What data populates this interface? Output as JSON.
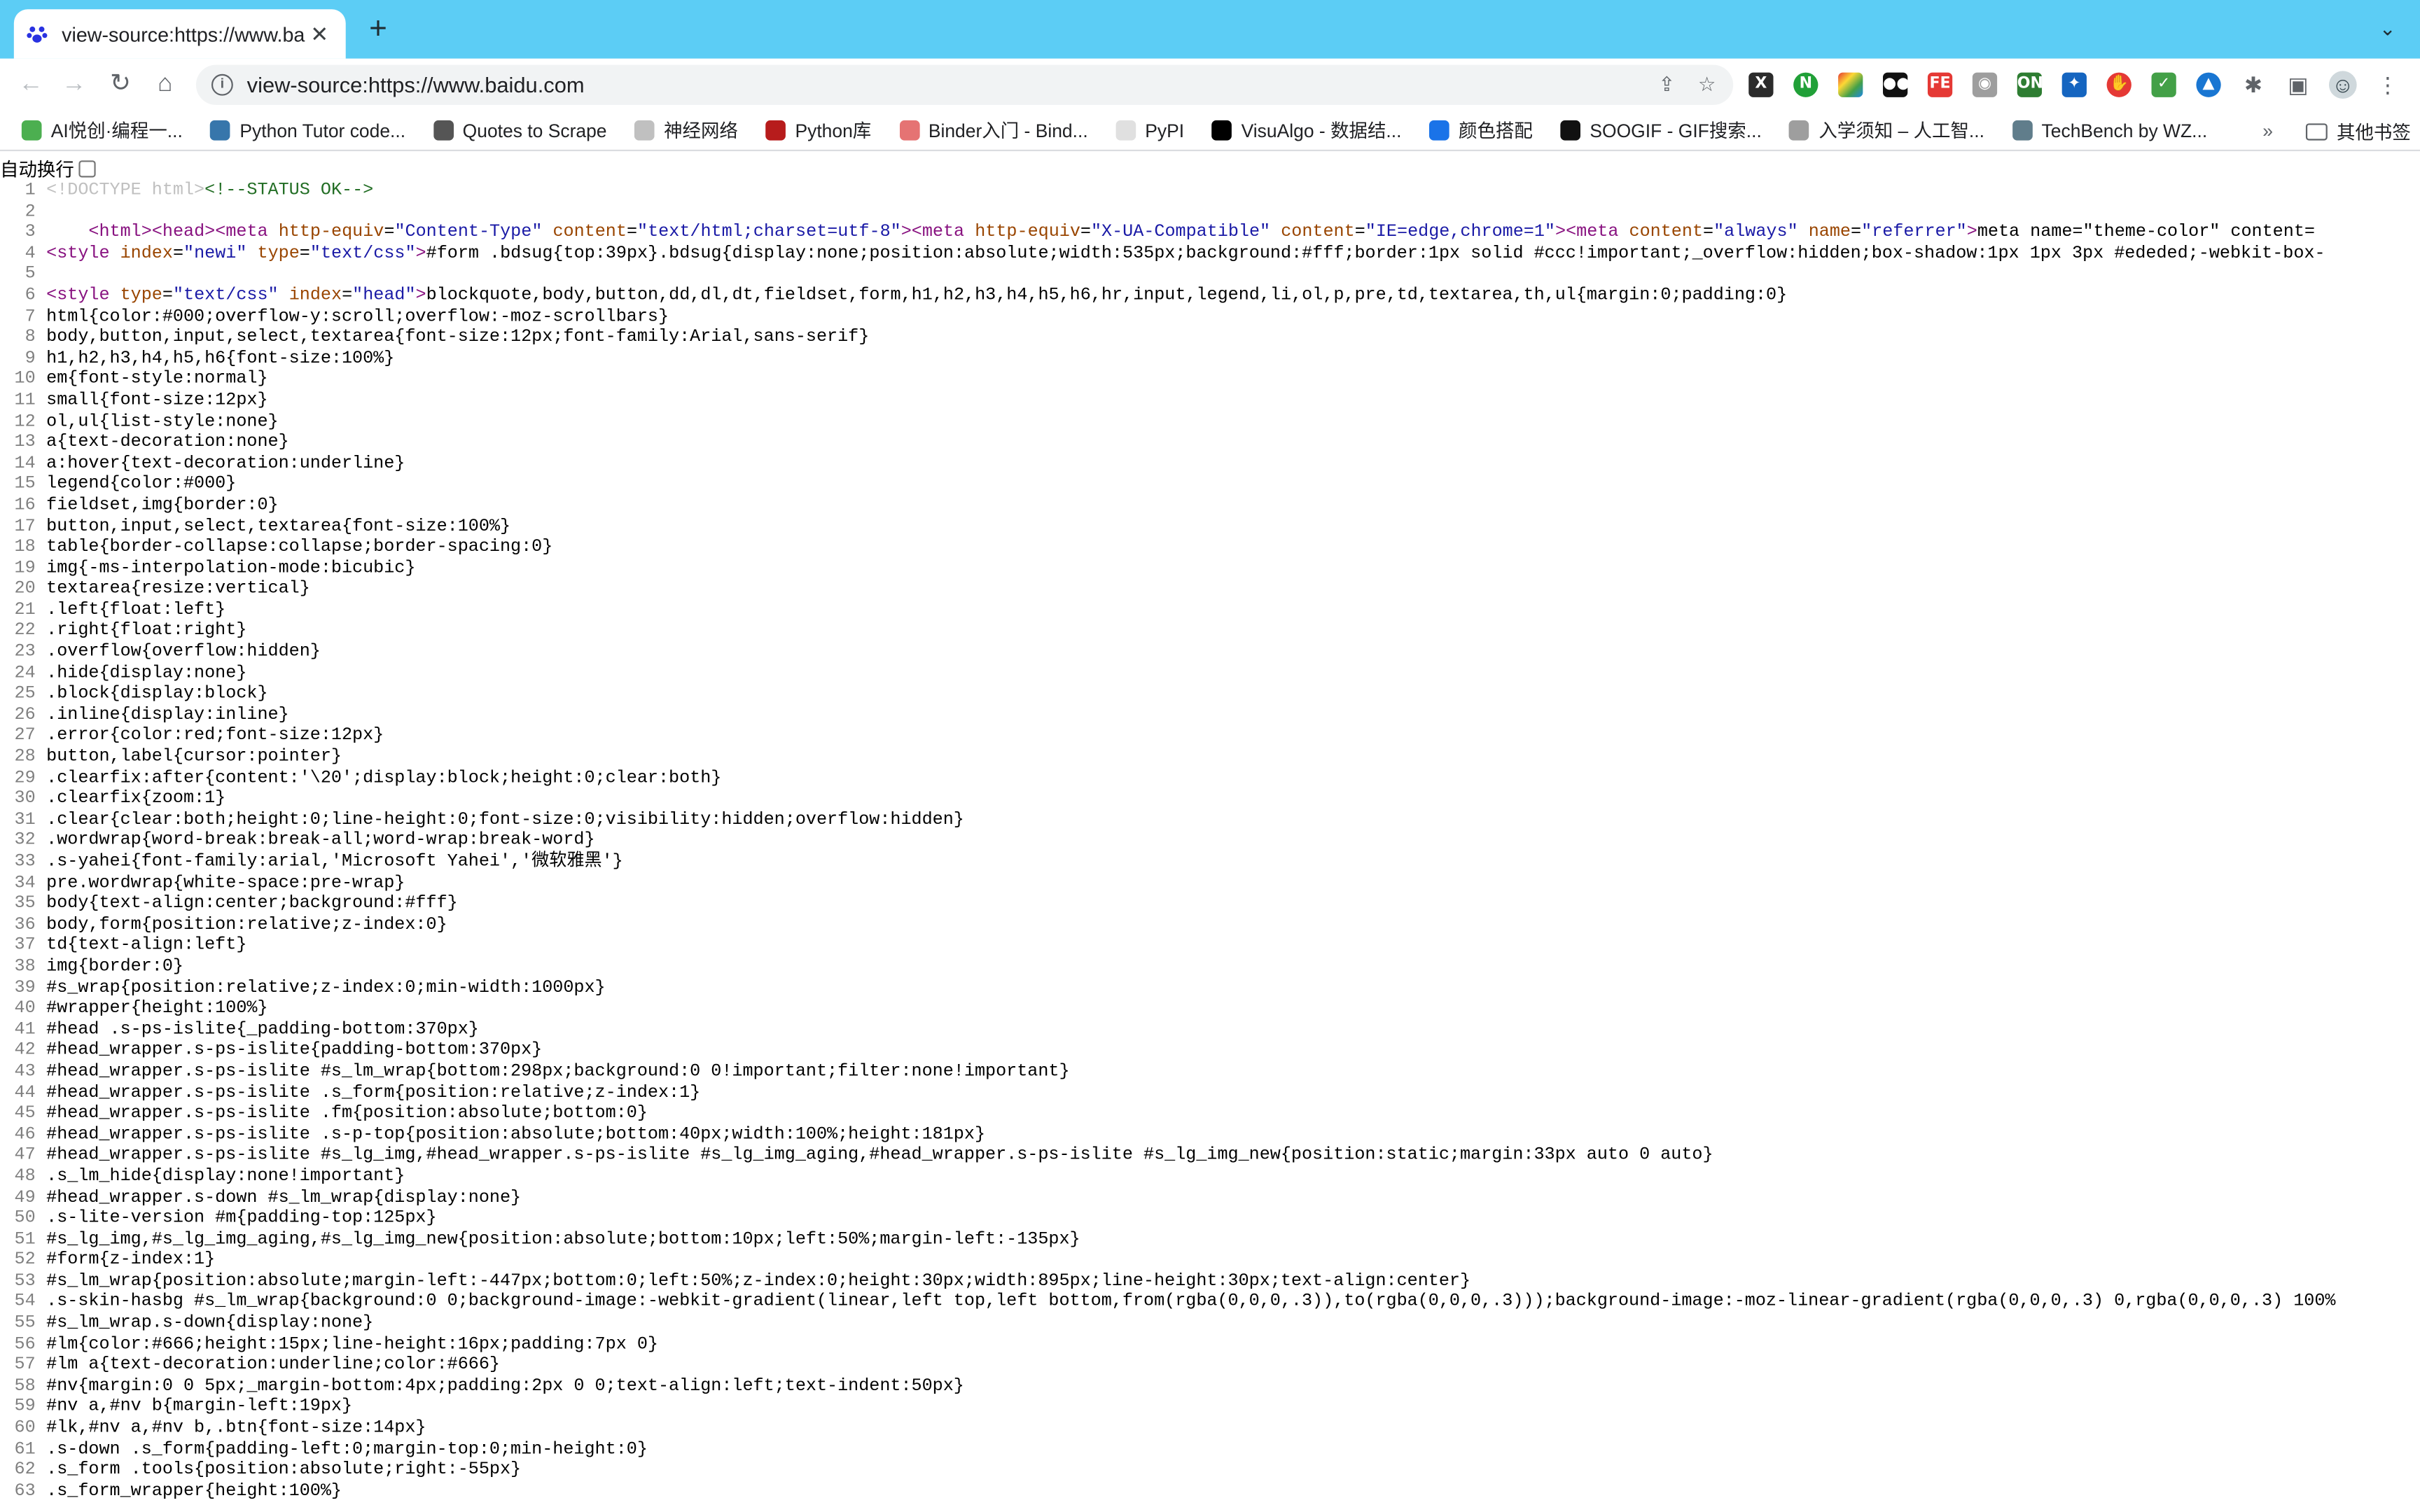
{
  "browser": {
    "tab_title": "view-source:https://www.baidu.com",
    "url": "view-source:https://www.baidu.com"
  },
  "bookmarks": {
    "items": [
      {
        "label": "AI悦创·编程一...",
        "color": "#4caf50"
      },
      {
        "label": "Python Tutor code...",
        "color": "#3776ab"
      },
      {
        "label": "Quotes to Scrape",
        "color": "#555555"
      },
      {
        "label": "神经网络",
        "color": "#c0c0c0"
      },
      {
        "label": "Python库",
        "color": "#b71c1c"
      },
      {
        "label": "Binder入门 - Bind...",
        "color": "#e57373"
      },
      {
        "label": "PyPI",
        "color": "#e0e0e0"
      },
      {
        "label": "VisuAlgo - 数据结...",
        "color": "#000000"
      },
      {
        "label": "颜色搭配",
        "color": "#1a73e8"
      },
      {
        "label": "SOOGIF - GIF搜索...",
        "color": "#111111"
      },
      {
        "label": "入学须知 – 人工智...",
        "color": "#9e9e9e"
      },
      {
        "label": "TechBench by WZ...",
        "color": "#607d8b"
      }
    ],
    "more": "»",
    "other_label": "其他书签"
  },
  "source_view": {
    "wrap_label": "自动换行",
    "lines": [
      {
        "n": "1",
        "t": "<!DOCTYPE html><!--STATUS OK-->"
      },
      {
        "n": "2",
        "t": ""
      },
      {
        "n": "3",
        "t": "    <html><head><meta http-equiv=\"Content-Type\" content=\"text/html;charset=utf-8\"><meta http-equiv=\"X-UA-Compatible\" content=\"IE=edge,chrome=1\"><meta content=\"always\" name=\"referrer\"><meta name=\"theme-color\" content="
      },
      {
        "n": "4",
        "t": "<style index=\"newi\" type=\"text/css\">#form .bdsug{top:39px}.bdsug{display:none;position:absolute;width:535px;background:#fff;border:1px solid #ccc!important;_overflow:hidden;box-shadow:1px 1px 3px #ededed;-webkit-box-"
      },
      {
        "n": "5",
        "t": ""
      },
      {
        "n": "6",
        "t": "<style type=\"text/css\" index=\"head\">blockquote,body,button,dd,dl,dt,fieldset,form,h1,h2,h3,h4,h5,h6,hr,input,legend,li,ol,p,pre,td,textarea,th,ul{margin:0;padding:0}"
      },
      {
        "n": "7",
        "t": "html{color:#000;overflow-y:scroll;overflow:-moz-scrollbars}"
      },
      {
        "n": "8",
        "t": "body,button,input,select,textarea{font-size:12px;font-family:Arial,sans-serif}"
      },
      {
        "n": "9",
        "t": "h1,h2,h3,h4,h5,h6{font-size:100%}"
      },
      {
        "n": "10",
        "t": "em{font-style:normal}"
      },
      {
        "n": "11",
        "t": "small{font-size:12px}"
      },
      {
        "n": "12",
        "t": "ol,ul{list-style:none}"
      },
      {
        "n": "13",
        "t": "a{text-decoration:none}"
      },
      {
        "n": "14",
        "t": "a:hover{text-decoration:underline}"
      },
      {
        "n": "15",
        "t": "legend{color:#000}"
      },
      {
        "n": "16",
        "t": "fieldset,img{border:0}"
      },
      {
        "n": "17",
        "t": "button,input,select,textarea{font-size:100%}"
      },
      {
        "n": "18",
        "t": "table{border-collapse:collapse;border-spacing:0}"
      },
      {
        "n": "19",
        "t": "img{-ms-interpolation-mode:bicubic}"
      },
      {
        "n": "20",
        "t": "textarea{resize:vertical}"
      },
      {
        "n": "21",
        "t": ".left{float:left}"
      },
      {
        "n": "22",
        "t": ".right{float:right}"
      },
      {
        "n": "23",
        "t": ".overflow{overflow:hidden}"
      },
      {
        "n": "24",
        "t": ".hide{display:none}"
      },
      {
        "n": "25",
        "t": ".block{display:block}"
      },
      {
        "n": "26",
        "t": ".inline{display:inline}"
      },
      {
        "n": "27",
        "t": ".error{color:red;font-size:12px}"
      },
      {
        "n": "28",
        "t": "button,label{cursor:pointer}"
      },
      {
        "n": "29",
        "t": ".clearfix:after{content:'\\20';display:block;height:0;clear:both}"
      },
      {
        "n": "30",
        "t": ".clearfix{zoom:1}"
      },
      {
        "n": "31",
        "t": ".clear{clear:both;height:0;line-height:0;font-size:0;visibility:hidden;overflow:hidden}"
      },
      {
        "n": "32",
        "t": ".wordwrap{word-break:break-all;word-wrap:break-word}"
      },
      {
        "n": "33",
        "t": ".s-yahei{font-family:arial,'Microsoft Yahei','微软雅黑'}"
      },
      {
        "n": "34",
        "t": "pre.wordwrap{white-space:pre-wrap}"
      },
      {
        "n": "35",
        "t": "body{text-align:center;background:#fff}"
      },
      {
        "n": "36",
        "t": "body,form{position:relative;z-index:0}"
      },
      {
        "n": "37",
        "t": "td{text-align:left}"
      },
      {
        "n": "38",
        "t": "img{border:0}"
      },
      {
        "n": "39",
        "t": "#s_wrap{position:relative;z-index:0;min-width:1000px}"
      },
      {
        "n": "40",
        "t": "#wrapper{height:100%}"
      },
      {
        "n": "41",
        "t": "#head .s-ps-islite{_padding-bottom:370px}"
      },
      {
        "n": "42",
        "t": "#head_wrapper.s-ps-islite{padding-bottom:370px}"
      },
      {
        "n": "43",
        "t": "#head_wrapper.s-ps-islite #s_lm_wrap{bottom:298px;background:0 0!important;filter:none!important}"
      },
      {
        "n": "44",
        "t": "#head_wrapper.s-ps-islite .s_form{position:relative;z-index:1}"
      },
      {
        "n": "45",
        "t": "#head_wrapper.s-ps-islite .fm{position:absolute;bottom:0}"
      },
      {
        "n": "46",
        "t": "#head_wrapper.s-ps-islite .s-p-top{position:absolute;bottom:40px;width:100%;height:181px}"
      },
      {
        "n": "47",
        "t": "#head_wrapper.s-ps-islite #s_lg_img,#head_wrapper.s-ps-islite #s_lg_img_aging,#head_wrapper.s-ps-islite #s_lg_img_new{position:static;margin:33px auto 0 auto}"
      },
      {
        "n": "48",
        "t": ".s_lm_hide{display:none!important}"
      },
      {
        "n": "49",
        "t": "#head_wrapper.s-down #s_lm_wrap{display:none}"
      },
      {
        "n": "50",
        "t": ".s-lite-version #m{padding-top:125px}"
      },
      {
        "n": "51",
        "t": "#s_lg_img,#s_lg_img_aging,#s_lg_img_new{position:absolute;bottom:10px;left:50%;margin-left:-135px}"
      },
      {
        "n": "52",
        "t": "#form{z-index:1}"
      },
      {
        "n": "53",
        "t": "#s_lm_wrap{position:absolute;margin-left:-447px;bottom:0;left:50%;z-index:0;height:30px;width:895px;line-height:30px;text-align:center}"
      },
      {
        "n": "54",
        "t": ".s-skin-hasbg #s_lm_wrap{background:0 0;background-image:-webkit-gradient(linear,left top,left bottom,from(rgba(0,0,0,.3)),to(rgba(0,0,0,.3)));background-image:-moz-linear-gradient(rgba(0,0,0,.3) 0,rgba(0,0,0,.3) 100%"
      },
      {
        "n": "55",
        "t": "#s_lm_wrap.s-down{display:none}"
      },
      {
        "n": "56",
        "t": "#lm{color:#666;height:15px;line-height:16px;padding:7px 0}"
      },
      {
        "n": "57",
        "t": "#lm a{text-decoration:underline;color:#666}"
      },
      {
        "n": "58",
        "t": "#nv{margin:0 0 5px;_margin-bottom:4px;padding:2px 0 0;text-align:left;text-indent:50px}"
      },
      {
        "n": "59",
        "t": "#nv a,#nv b{margin-left:19px}"
      },
      {
        "n": "60",
        "t": "#lk,#nv a,#nv b,.btn{font-size:14px}"
      },
      {
        "n": "61",
        "t": ".s-down .s_form{padding-left:0;margin-top:0;min-height:0}"
      },
      {
        "n": "62",
        "t": ".s_form .tools{position:absolute;right:-55px}"
      },
      {
        "n": "63",
        "t": ".s_form_wrapper{height:100%}"
      }
    ]
  }
}
